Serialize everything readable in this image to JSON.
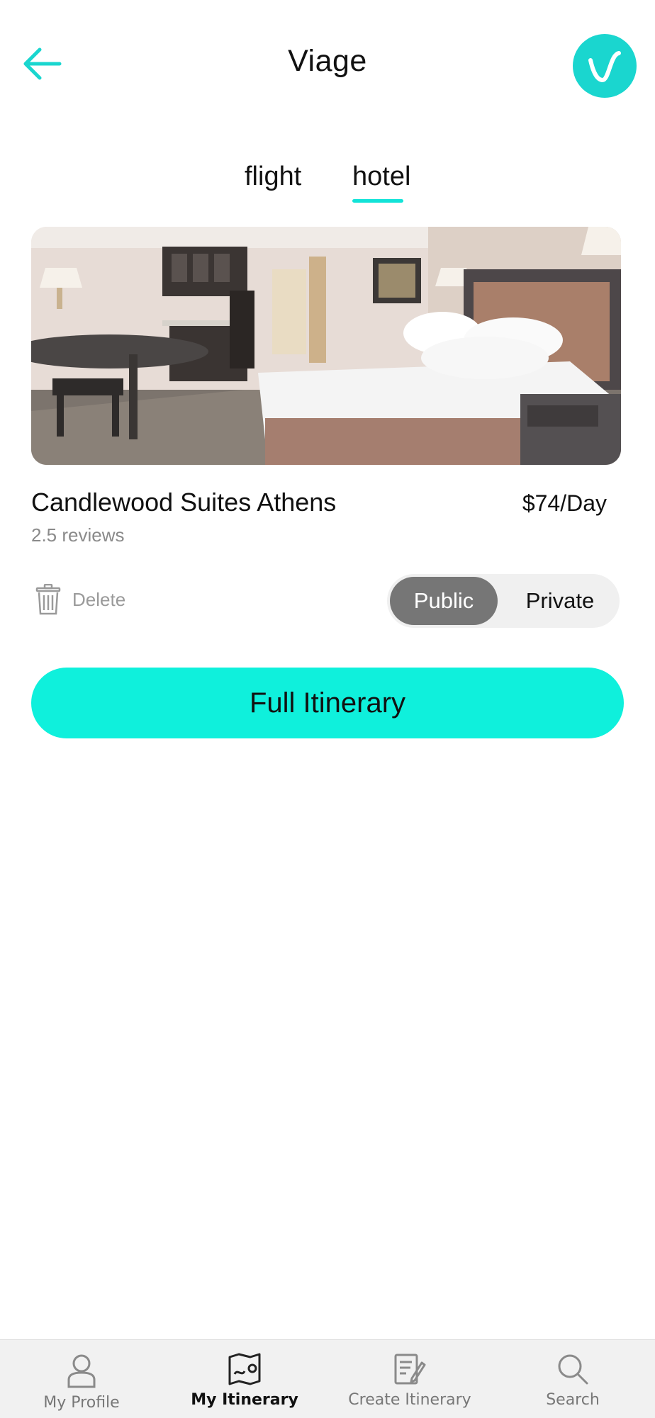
{
  "header": {
    "title": "Viage",
    "back_icon": "arrow-left-icon",
    "logo_icon": "viage-logo-icon",
    "accent_color": "#1ad6cf"
  },
  "tabs": [
    {
      "label": "flight",
      "active": false
    },
    {
      "label": "hotel",
      "active": true
    }
  ],
  "hotel": {
    "image_icon": "hotel-room-photo",
    "name": "Candlewood Suites Athens",
    "price": "$74/Day",
    "reviews": "2.5 reviews"
  },
  "actions": {
    "delete_label": "Delete",
    "delete_icon": "trash-icon",
    "visibility": {
      "public_label": "Public",
      "private_label": "Private",
      "selected": "Public"
    }
  },
  "cta": {
    "full_itinerary_label": "Full Itinerary",
    "color": "#0ff0dc"
  },
  "bottom_nav": {
    "items": [
      {
        "label": "My Profile",
        "icon": "user-icon",
        "active": false
      },
      {
        "label": "My Itinerary",
        "icon": "map-icon",
        "active": true
      },
      {
        "label": "Create Itinerary",
        "icon": "edit-document-icon",
        "active": false
      },
      {
        "label": "Search",
        "icon": "search-icon",
        "active": false
      }
    ]
  }
}
